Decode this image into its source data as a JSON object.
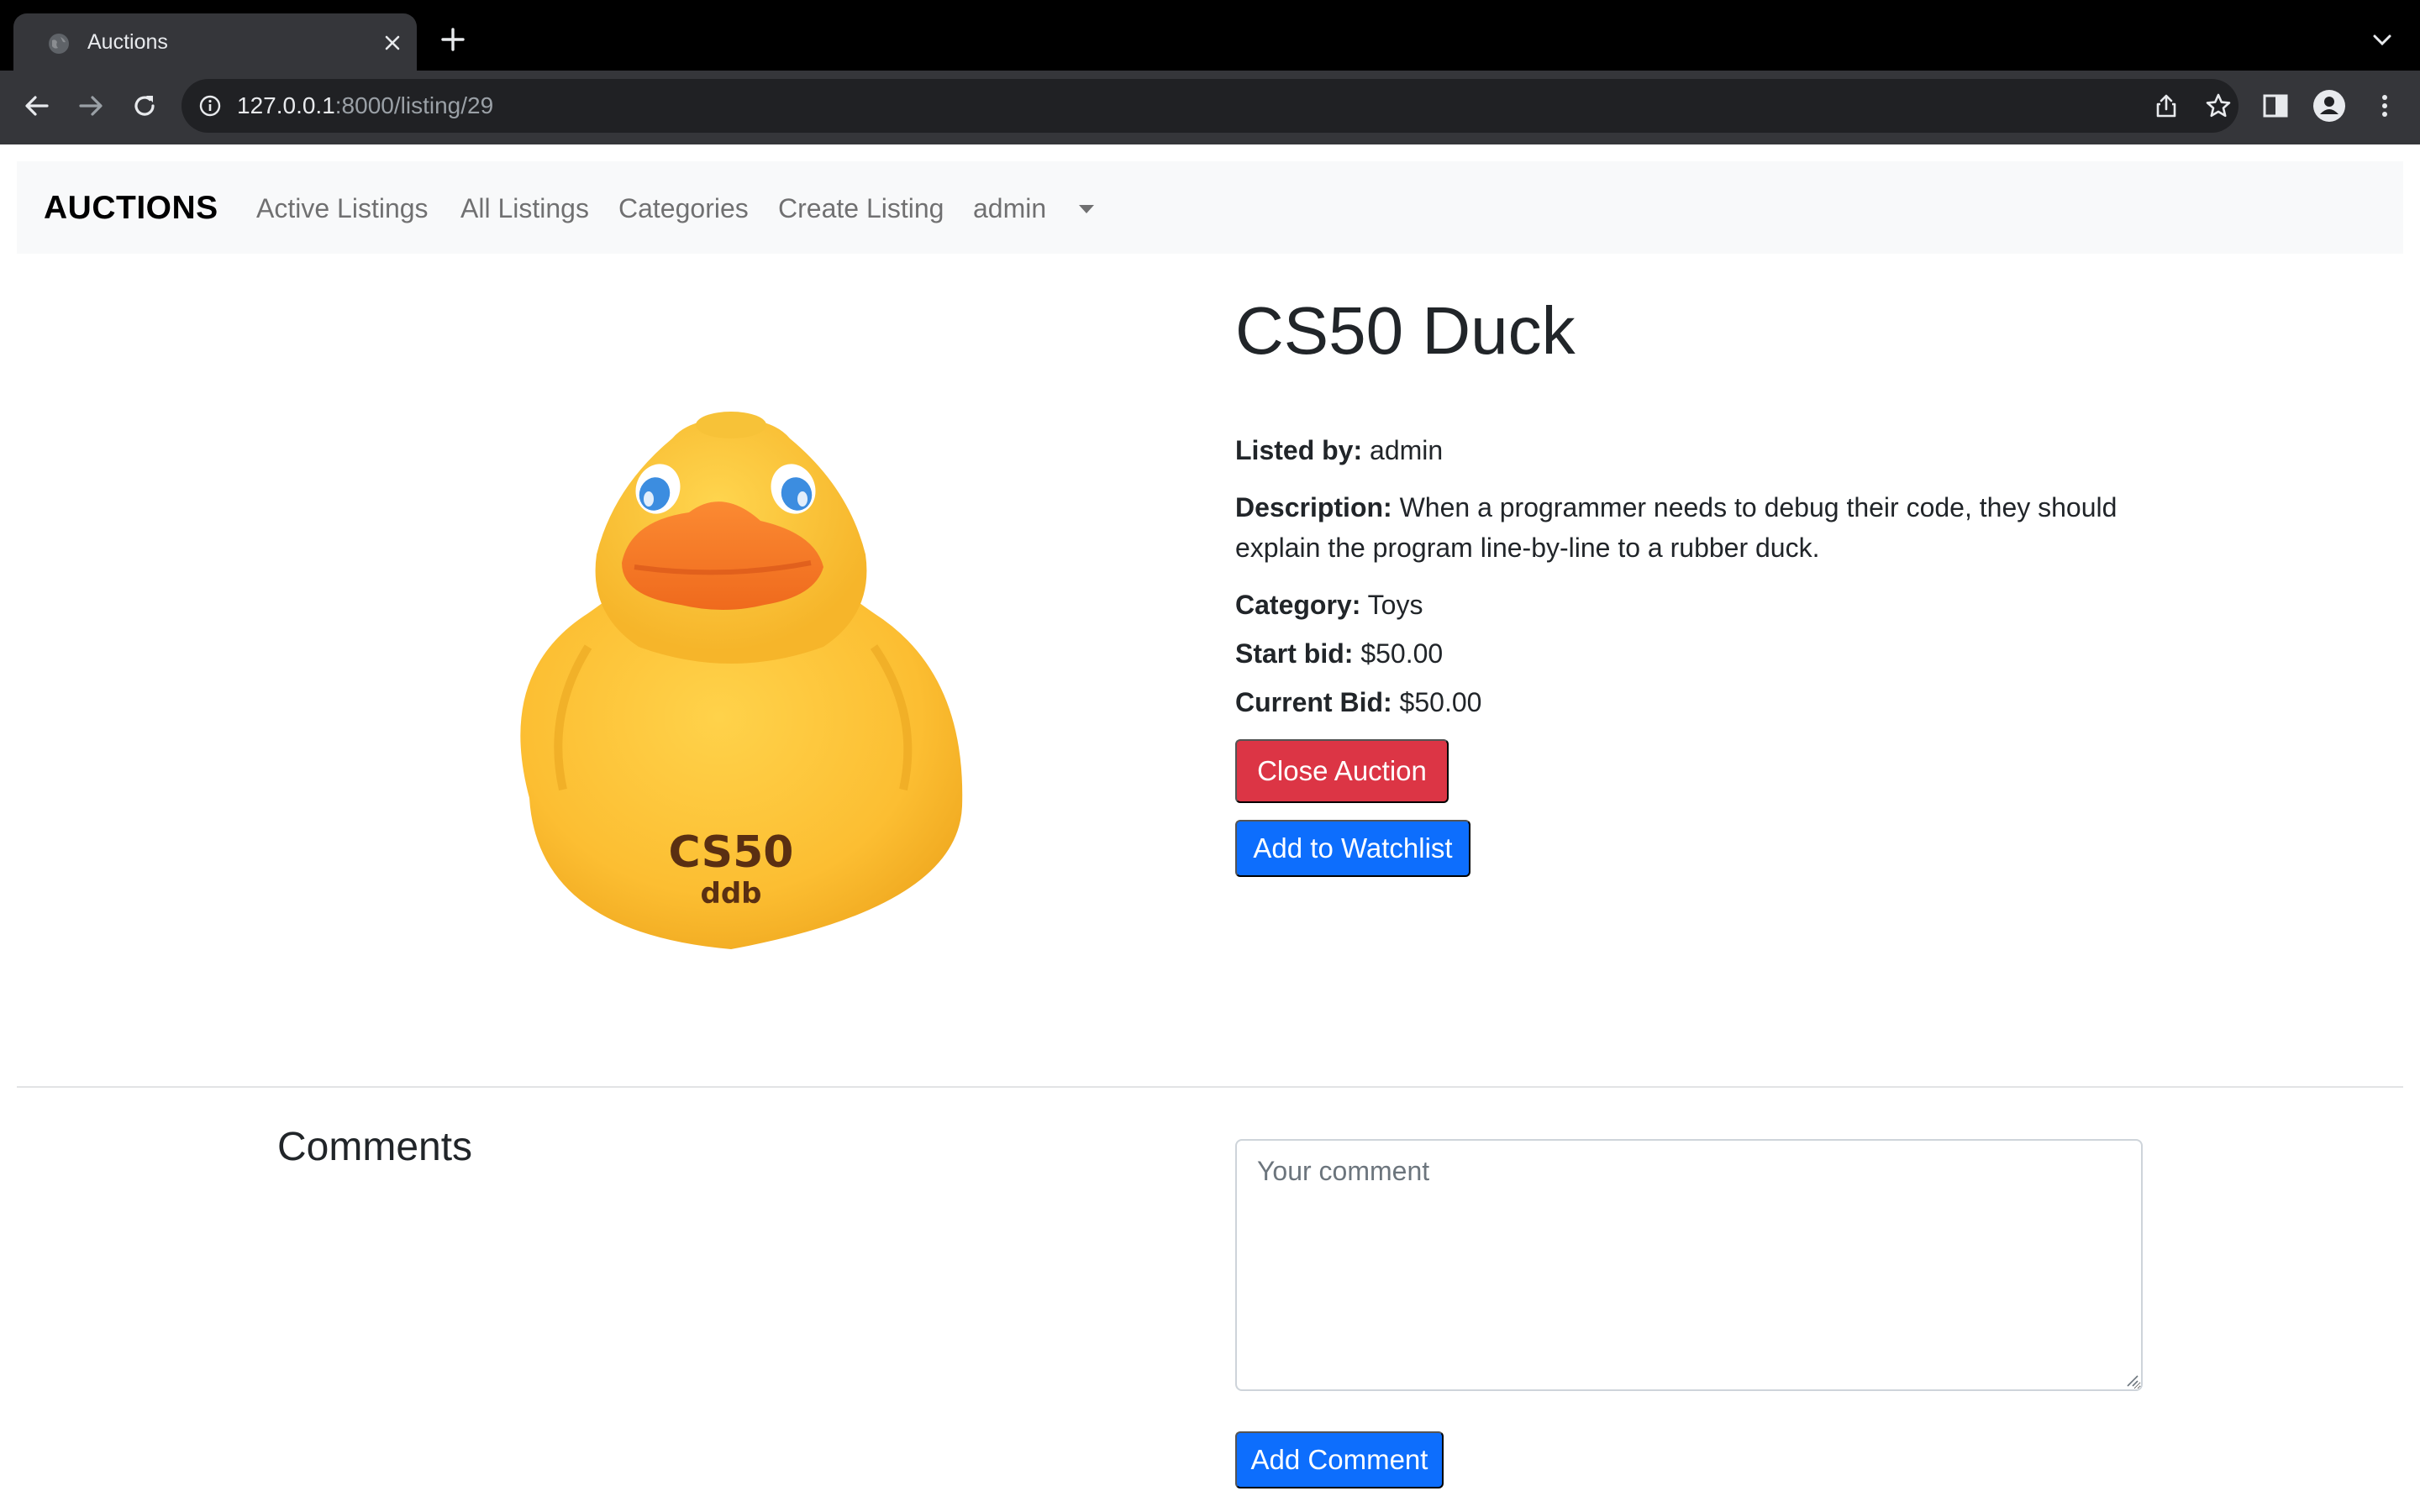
{
  "browser": {
    "tab_title": "Auctions",
    "url_host": "127.0.0.1",
    "url_rest": ":8000/listing/29",
    "icons": {
      "favicon": "globe-icon",
      "close": "close-icon",
      "new_tab": "plus-icon",
      "tab_menu": "chevron-down-icon",
      "back": "arrow-left-icon",
      "forward": "arrow-right-icon",
      "reload": "reload-icon",
      "site_info": "info-icon",
      "share": "share-icon",
      "bookmark": "star-icon",
      "side_panel": "side-panel-icon",
      "profile": "profile-icon",
      "menu": "kebab-menu-icon"
    }
  },
  "navbar": {
    "brand": "AUCTIONS",
    "links": [
      "Active Listings",
      "All Listings",
      "Categories",
      "Create Listing"
    ],
    "user": "admin"
  },
  "listing": {
    "title": "CS50 Duck",
    "image_text": [
      "CS50",
      "ddb"
    ],
    "listed_by_label": "Listed by:",
    "listed_by": "admin",
    "description_label": "Description:",
    "description_line1": "When a programmer needs to debug their code, they should",
    "description_line2": "explain the program line-by-line to a rubber duck.",
    "category_label": "Category:",
    "category": "Toys",
    "start_bid_label": "Start bid:",
    "start_bid": "$50.00",
    "current_bid_label": "Current Bid:",
    "current_bid": "$50.00",
    "close_button": "Close Auction",
    "watchlist_button": "Add to Watchlist"
  },
  "comments": {
    "heading": "Comments",
    "placeholder": "Your comment",
    "value": "",
    "submit_button": "Add Comment"
  },
  "colors": {
    "danger": "#dc3545",
    "primary": "#0d6efd",
    "duck_yellow": "#fcc03a",
    "duck_beak": "#f47a28"
  }
}
